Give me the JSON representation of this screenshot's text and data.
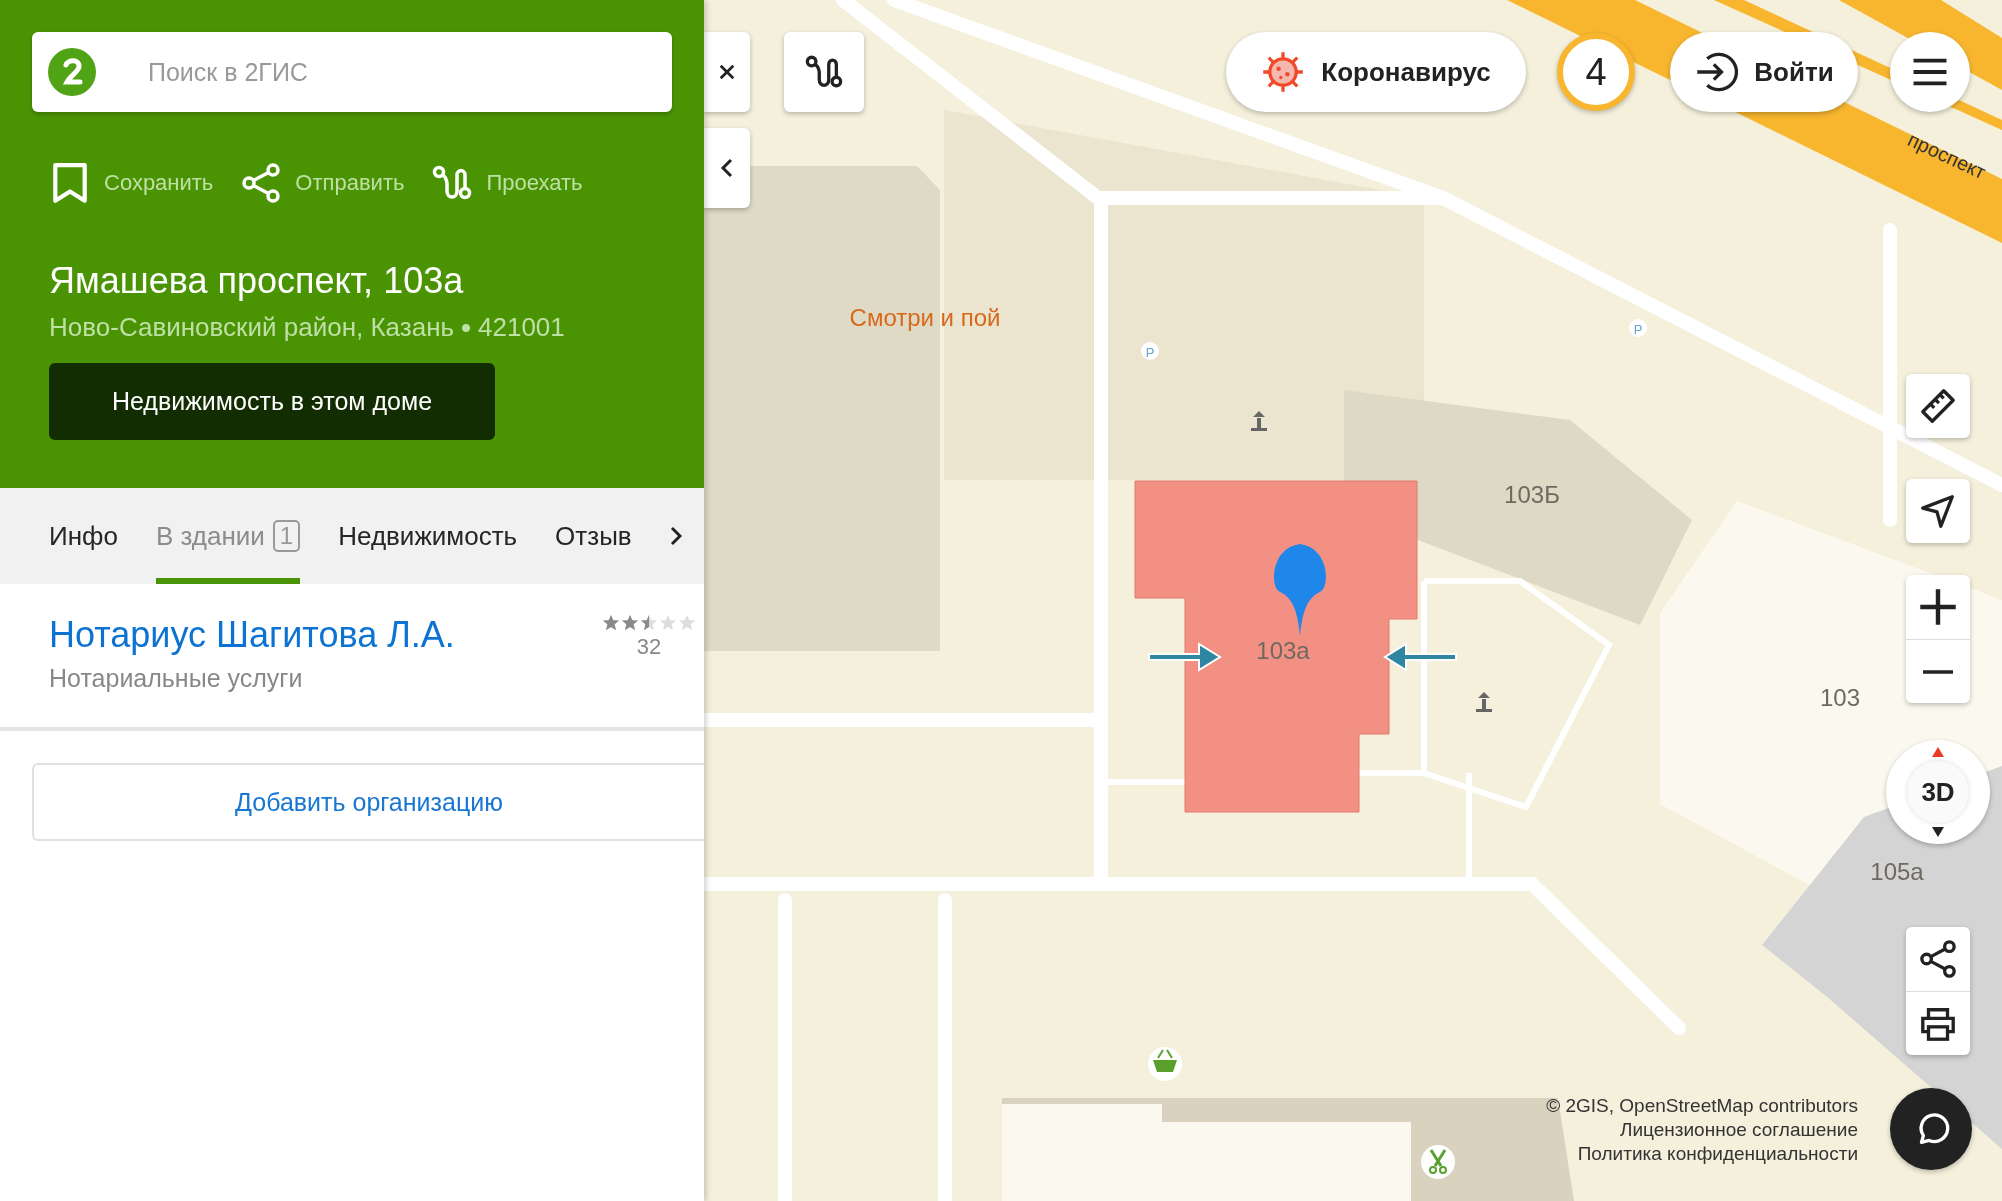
{
  "search": {
    "placeholder": "Поиск в 2ГИС"
  },
  "actions": [
    {
      "kind": "save",
      "label": "Сохранить"
    },
    {
      "kind": "share",
      "label": "Отправить"
    },
    {
      "kind": "route",
      "label": "Проехать"
    }
  ],
  "place": {
    "title": "Ямашева проспект, 103а",
    "district": "Ново-Савиновский район, Казань",
    "postcode": "421001",
    "cta": "Недвижимость в этом доме"
  },
  "tabs": [
    {
      "label": "Инфо",
      "selected": false
    },
    {
      "label": "В здании",
      "badge": "1",
      "selected": true
    },
    {
      "label": "Недвижимость",
      "selected": false
    },
    {
      "label": "Отзыв",
      "selected": false
    }
  ],
  "results": [
    {
      "name": "Нотариус Шагитова Л.А.",
      "category": "Нотариальные услуги",
      "stars": 2.5,
      "reviews": "32"
    }
  ],
  "add_button": "Добавить организацию",
  "map": {
    "labels": [
      {
        "kind": "poi",
        "text": "Смотри и пой"
      },
      {
        "kind": "building",
        "text": "103Б"
      },
      {
        "kind": "building",
        "text": "103а"
      },
      {
        "kind": "building",
        "text": "103"
      },
      {
        "kind": "building",
        "text": "105а"
      },
      {
        "kind": "street",
        "text": "проспект"
      },
      {
        "kind": "parking",
        "text": "P"
      },
      {
        "kind": "parking",
        "text": "P"
      }
    ],
    "covid": "Коронавирус",
    "notifications": "4",
    "login": "Войти",
    "compass": "3D",
    "attribution": [
      "© 2GIS, OpenStreetMap contributors",
      "Лицензионное соглашение",
      "Политика конфиденциальности"
    ]
  }
}
